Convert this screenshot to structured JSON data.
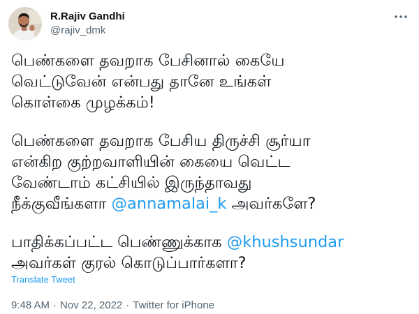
{
  "user": {
    "display_name": "R.Rajiv Gandhi",
    "handle": "@rajiv_dmk",
    "avatar_icon": "profile-photo"
  },
  "more_icon": "more-options-icon",
  "tweet": {
    "para1": {
      "line1": "பெண்களை தவறாக பேசினால் கையே",
      "line2": "வெட்டுவேன் என்பது தானே உங்கள்",
      "line3": "கொள்கை முழக்கம்!"
    },
    "para2": {
      "line1": "பெண்களை தவறாக பேசிய திருச்சி சூர்யா",
      "line2": "என்கிற குற்றவாளியின் கையை வெட்ட",
      "line3": "வேண்டாம் கட்சியில் இருந்தாவது",
      "line4_pre": "நீக்குவீங்களா ",
      "line4_mention": "@annamalai_k",
      "line4_post": " அவர்களே?"
    },
    "para3": {
      "line1_pre": "பாதிக்கப்பட்ட பெண்ணுக்காக ",
      "line1_mention": "@khushsundar",
      "line2": "அவர்கள் குரல் கொடுப்பார்களா?"
    }
  },
  "translate_label": "Translate Tweet",
  "meta": {
    "time": "9:48 AM",
    "separator": "·",
    "date": "Nov 22, 2022",
    "source": "Twitter for iPhone"
  },
  "colors": {
    "link": "#1d9bf0",
    "secondary_text": "#536471",
    "primary_text": "#0f1419"
  }
}
